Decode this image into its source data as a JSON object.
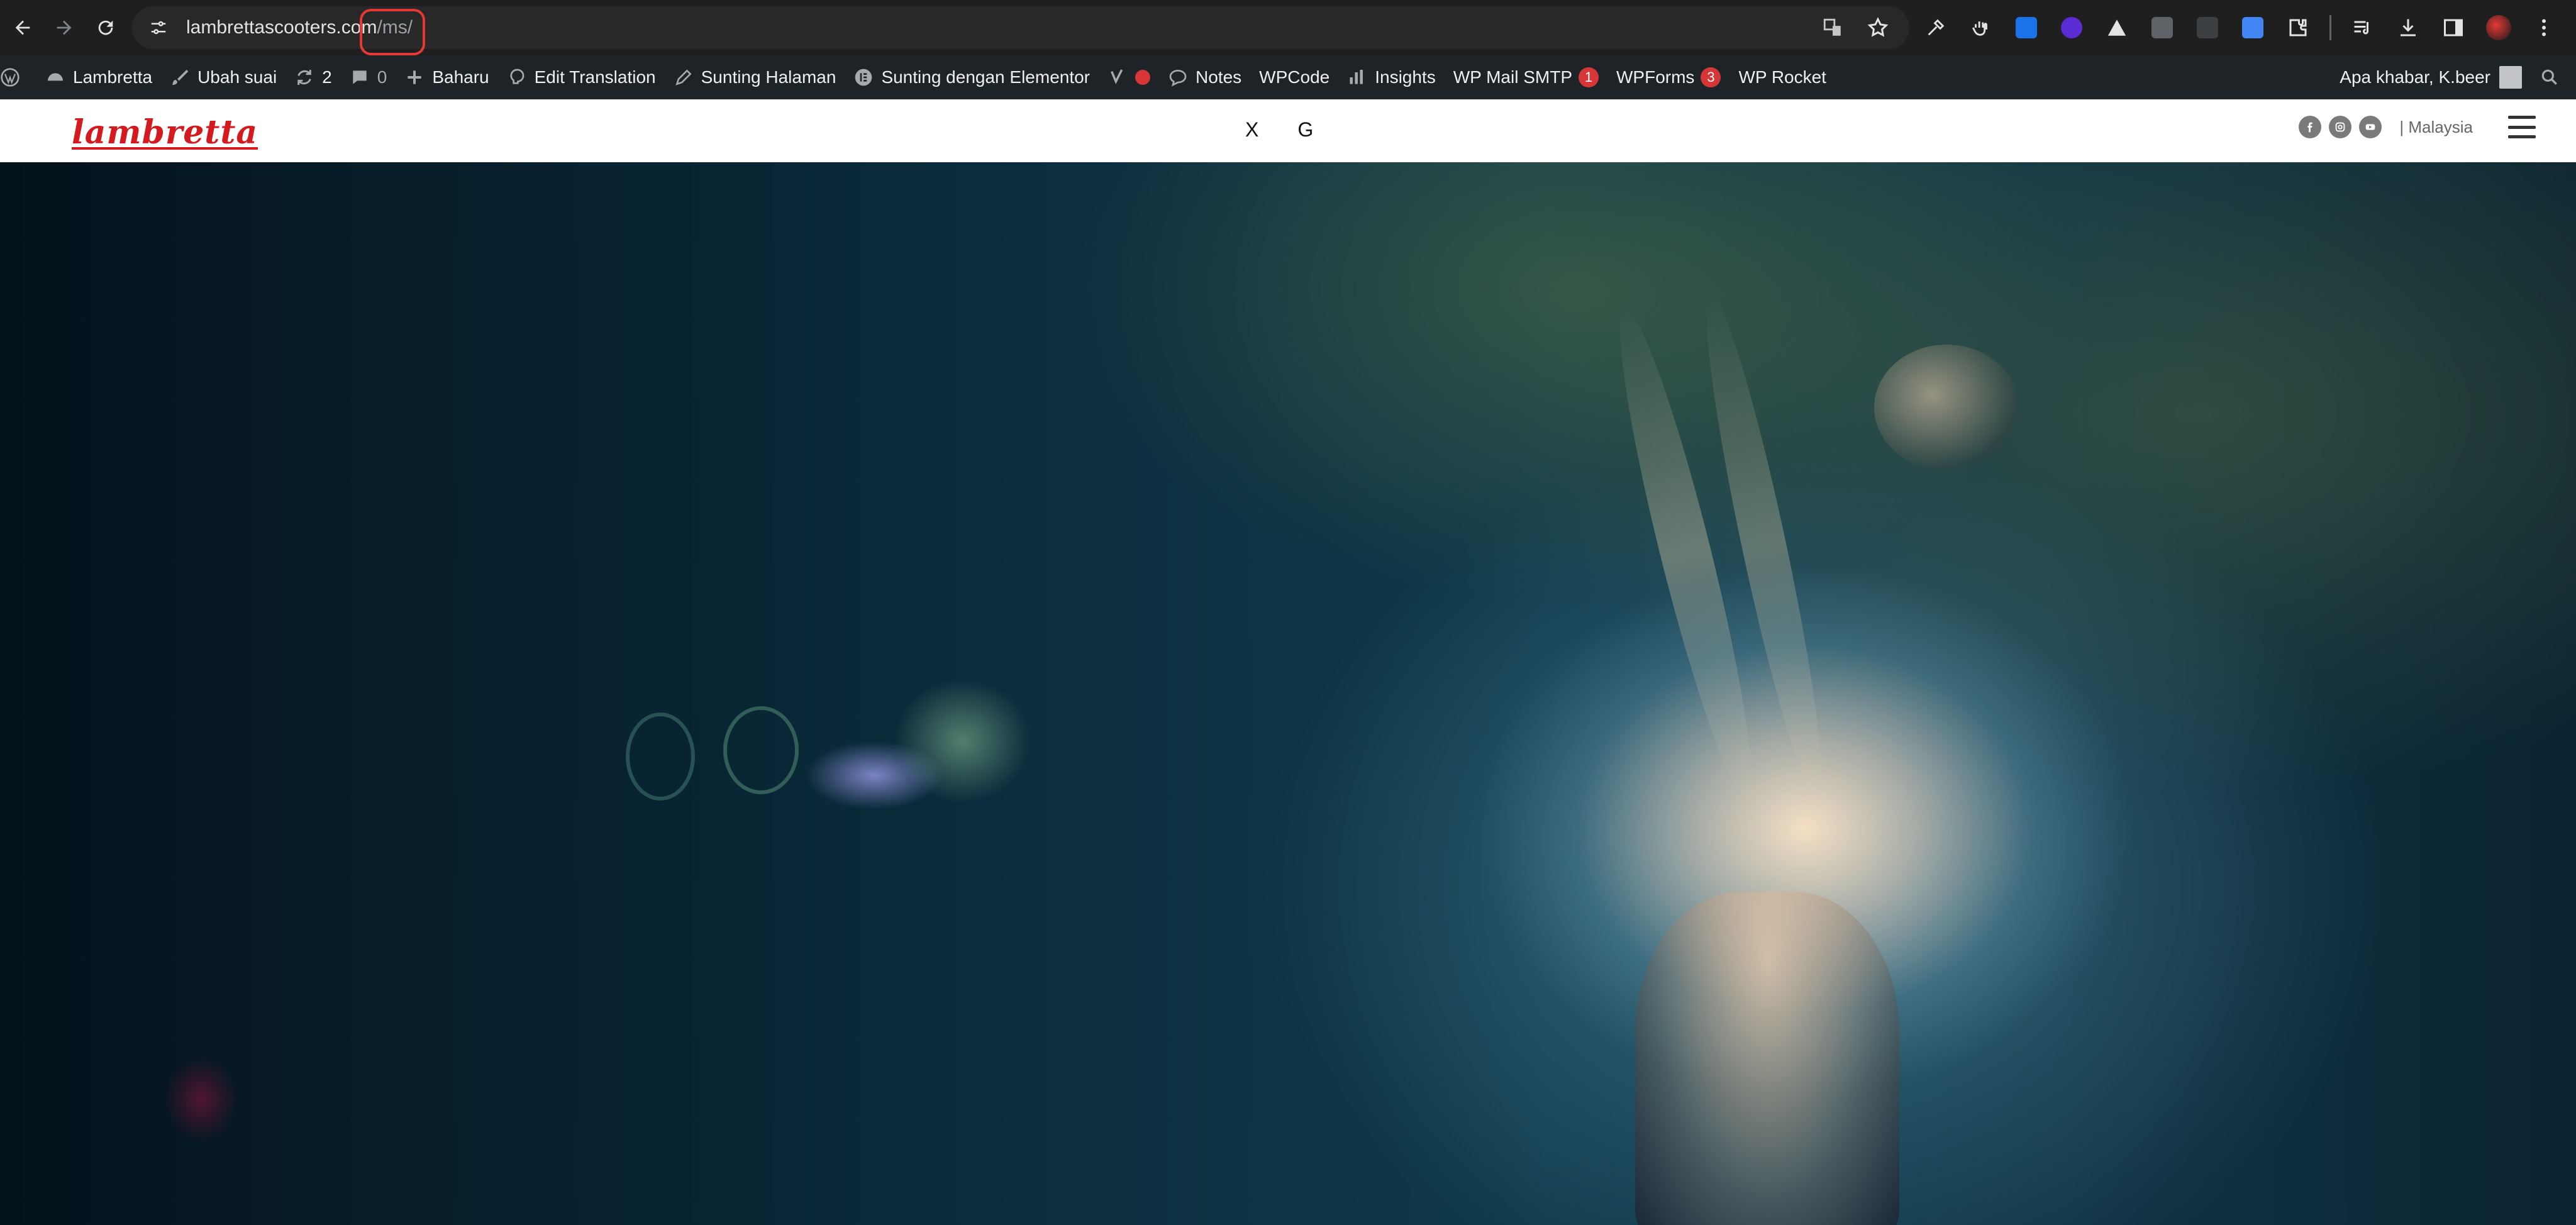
{
  "browser": {
    "url_host": "lambrettascooters.com",
    "url_path": "/ms/",
    "icons": [
      "back-icon",
      "forward-icon",
      "reload-icon",
      "site-info-icon",
      "translate-icon",
      "bookmark-star-icon"
    ],
    "extension_icons": [
      "eyedropper-icon",
      "hand-icon",
      "s-extension-icon",
      "download-ext-icon",
      "triangle-ext-icon",
      "m-extension-icon",
      "code-ext-icon",
      "google-translate-icon",
      "puzzle-icon",
      "media-icon",
      "download-icon",
      "sidepanel-icon",
      "profile-icon",
      "menu-dots-icon"
    ]
  },
  "wp_admin_bar": {
    "items": [
      {
        "label": "Lambretta",
        "icon": "dashboard-icon"
      },
      {
        "label": "Ubah suai",
        "icon": "brush-icon"
      },
      {
        "label": "2",
        "icon": "updates-icon"
      },
      {
        "label": "0",
        "icon": "comment-icon"
      },
      {
        "label": "Baharu",
        "icon": "plus-icon"
      },
      {
        "label": "Edit Translation",
        "icon": "translation-icon"
      },
      {
        "label": "Sunting Halaman",
        "icon": "pencil-icon"
      },
      {
        "label": "Sunting dengan Elementor",
        "icon": "elementor-icon"
      },
      {
        "label": "Notes",
        "icon": "notes-icon"
      },
      {
        "label": "WPCode"
      },
      {
        "label": "Insights",
        "icon": "insights-icon"
      },
      {
        "label": "WP Mail SMTP",
        "badge": "1"
      },
      {
        "label": "WPForms",
        "badge": "3"
      },
      {
        "label": "WP Rocket"
      }
    ],
    "greeting": "Apa khabar, K.beer"
  },
  "site_header": {
    "logo_text": "lambretta",
    "center_links": [
      "X",
      "G"
    ],
    "social_icons": [
      "facebook-icon",
      "instagram-icon",
      "youtube-icon"
    ],
    "region": "| Malaysia"
  },
  "colors": {
    "brand_red": "#d4191f",
    "chrome_bg": "#1f1f1f",
    "wp_bar_bg": "#1d2327",
    "badge_red": "#d63638"
  }
}
